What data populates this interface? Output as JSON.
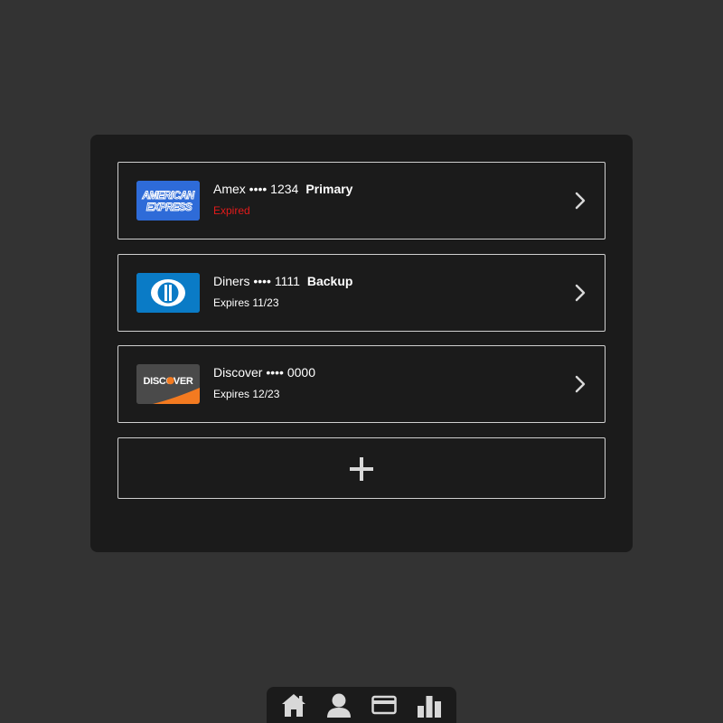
{
  "cards": [
    {
      "brand": "amex",
      "logo_lines": [
        "AMERICAN",
        "EXPRESS"
      ],
      "label": "Amex •••• 1234",
      "tag": "Primary",
      "status": "Expired",
      "expired": true,
      "logo_color": "#2e6bd8"
    },
    {
      "brand": "diners",
      "label": "Diners •••• 1111",
      "tag": "Backup",
      "status": "Expires 11/23",
      "expired": false,
      "logo_color": "#0a7bc6"
    },
    {
      "brand": "discover",
      "logo_text": "DISCOVER",
      "label": "Discover •••• 0000",
      "tag": "",
      "status": "Expires 12/23",
      "expired": false,
      "logo_color": "#4a4a4a",
      "accent_color": "#f37a20"
    }
  ],
  "add_button": {
    "icon": "plus-icon"
  },
  "nav": [
    {
      "icon": "home-icon"
    },
    {
      "icon": "user-icon"
    },
    {
      "icon": "credit-card-icon"
    },
    {
      "icon": "bar-chart-icon"
    }
  ],
  "colors": {
    "background": "#333333",
    "panel": "#1b1b1b",
    "border": "#cfcfcf",
    "expired": "#e21b1b",
    "icon": "#d8d8d8"
  }
}
